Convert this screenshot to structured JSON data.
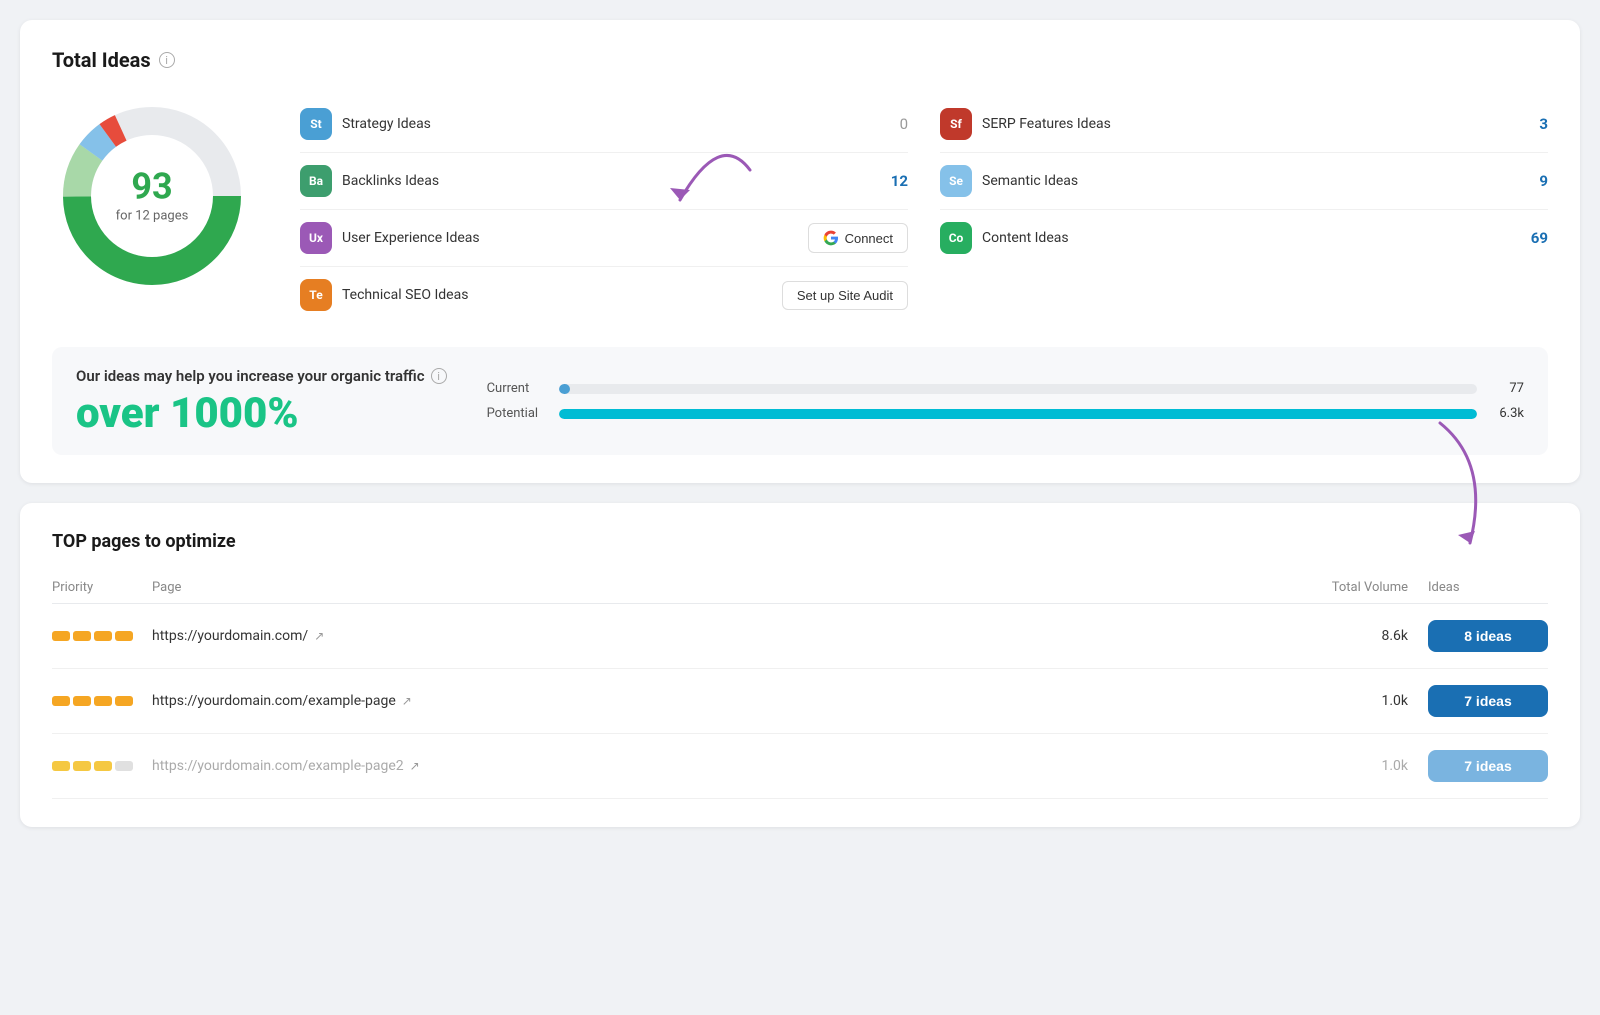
{
  "totalIdeas": {
    "title": "Total Ideas",
    "count": "93",
    "countLabel": "for 12 pages",
    "ideas": [
      {
        "badge": "St",
        "badgeColor": "#4a9fd4",
        "name": "Strategy Ideas",
        "count": "0",
        "isZero": true,
        "hasButton": false
      },
      {
        "badge": "Ba",
        "badgeColor": "#3d9e6e",
        "name": "Backlinks Ideas",
        "count": "12",
        "isZero": false,
        "hasButton": false
      },
      {
        "badge": "Ux",
        "badgeColor": "#9b59b6",
        "name": "User Experience Ideas",
        "count": null,
        "isZero": false,
        "hasButton": "connect"
      },
      {
        "badge": "Te",
        "badgeColor": "#e67e22",
        "name": "Technical SEO Ideas",
        "count": null,
        "isZero": false,
        "hasButton": "audit"
      }
    ],
    "ideasRight": [
      {
        "badge": "Sf",
        "badgeColor": "#c0392b",
        "name": "SERP Features Ideas",
        "count": "3",
        "isZero": false
      },
      {
        "badge": "Se",
        "badgeColor": "#85c1e9",
        "name": "Semantic Ideas",
        "count": "9",
        "isZero": false
      },
      {
        "badge": "Co",
        "badgeColor": "#27ae60",
        "name": "Content Ideas",
        "count": "69",
        "isZero": false
      }
    ],
    "connectLabel": "Connect",
    "auditLabel": "Set up Site Audit",
    "trafficTitle": "Our ideas may help you increase your organic traffic",
    "trafficPercent": "over 1000%",
    "currentLabel": "Current",
    "currentValue": "77",
    "currentPercent": 1.2,
    "potentialLabel": "Potential",
    "potentialValue": "6.3k",
    "potentialPercent": 100
  },
  "topPages": {
    "title": "TOP pages to optimize",
    "headers": {
      "priority": "Priority",
      "page": "Page",
      "volume": "Total Volume",
      "ideas": "Ideas"
    },
    "rows": [
      {
        "priorityColor": "#f5a623",
        "priorityFaded": false,
        "url": "https://yourdomain.com/",
        "volume": "8.6k",
        "ideas": "8 ideas",
        "faded": false
      },
      {
        "priorityColor": "#f5a623",
        "priorityFaded": false,
        "url": "https://yourdomain.com/example-page",
        "volume": "1.0k",
        "ideas": "7 ideas",
        "faded": false
      },
      {
        "priorityColor": "#f5c842",
        "priorityFaded": true,
        "url": "https://yourdomain.com/example-page2",
        "volume": "1.0k",
        "ideas": "7 ideas",
        "faded": true
      }
    ]
  }
}
